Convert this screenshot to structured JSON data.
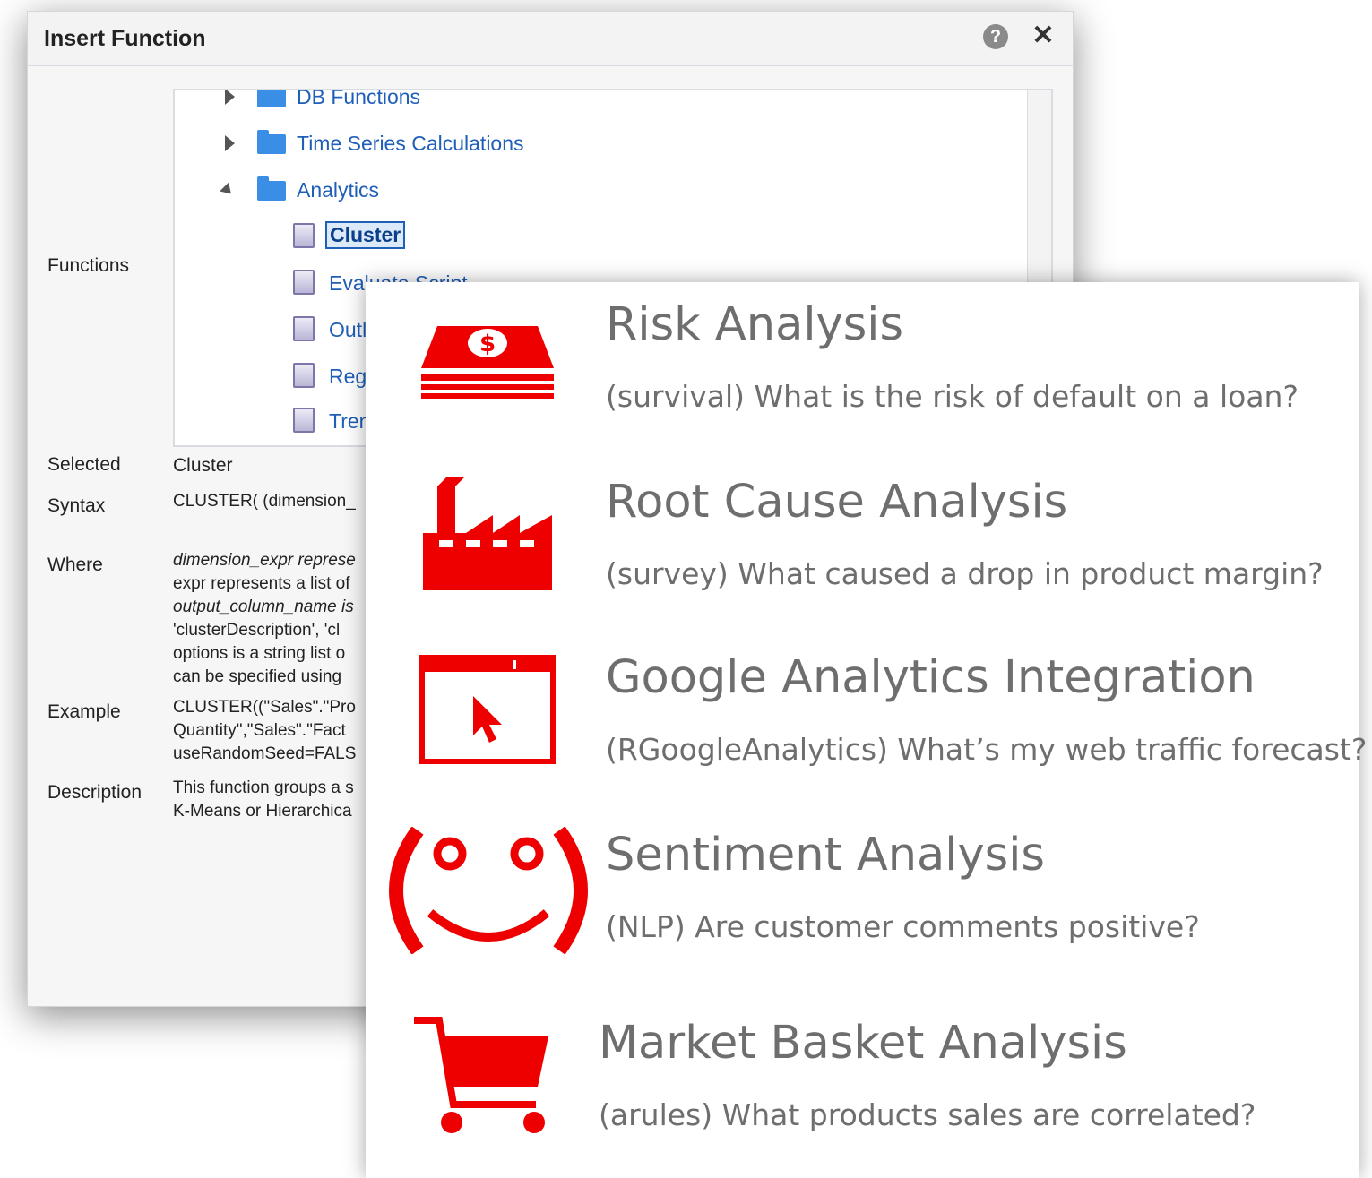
{
  "dialog": {
    "title": "Insert Function",
    "labels": {
      "functions": "Functions",
      "selected": "Selected",
      "syntax": "Syntax",
      "where": "Where",
      "example": "Example",
      "description": "Description"
    },
    "tree": [
      {
        "label": "DB Functions",
        "type": "folder",
        "state": "collapsed"
      },
      {
        "label": "Time Series Calculations",
        "type": "folder",
        "state": "collapsed"
      },
      {
        "label": "Analytics",
        "type": "folder",
        "state": "expanded"
      },
      {
        "label": "Cluster",
        "type": "function",
        "selected": true
      },
      {
        "label": "Evaluate Script",
        "type": "function"
      },
      {
        "label": "Outl",
        "type": "function"
      },
      {
        "label": "Reg",
        "type": "function"
      },
      {
        "label": "Tren",
        "type": "function"
      }
    ],
    "selected_value": "Cluster",
    "syntax_value": "CLUSTER( (dimension_",
    "where_lines": [
      "dimension_expr represe",
      "expr represents a list of",
      "output_column_name is",
      "'clusterDescription', 'cl",
      "options is a string list o",
      "can be specified using"
    ],
    "example_lines": [
      "CLUSTER((\"Sales\".\"Pro",
      "Quantity\",\"Sales\".\"Fact",
      "useRandomSeed=FALS"
    ],
    "description_lines": [
      "This function groups a s",
      "K-Means or Hierarchica"
    ]
  },
  "overlay": {
    "accent_color": "#ee0000",
    "items": [
      {
        "icon": "money-stack-icon",
        "title": "Risk Analysis",
        "subtitle": "(survival) What is the risk of default on a loan?"
      },
      {
        "icon": "factory-icon",
        "title": "Root Cause Analysis",
        "subtitle": "(survey) What caused a drop in product margin?"
      },
      {
        "icon": "browser-cursor-icon",
        "title": "Google Analytics Integration",
        "subtitle": "(RGoogleAnalytics) What’s my web traffic forecast?"
      },
      {
        "icon": "smiley-icon",
        "title": "Sentiment Analysis",
        "subtitle": "(NLP) Are customer comments positive?"
      },
      {
        "icon": "shopping-cart-icon",
        "title": "Market Basket Analysis",
        "subtitle": "(arules) What products sales are correlated?"
      }
    ]
  }
}
